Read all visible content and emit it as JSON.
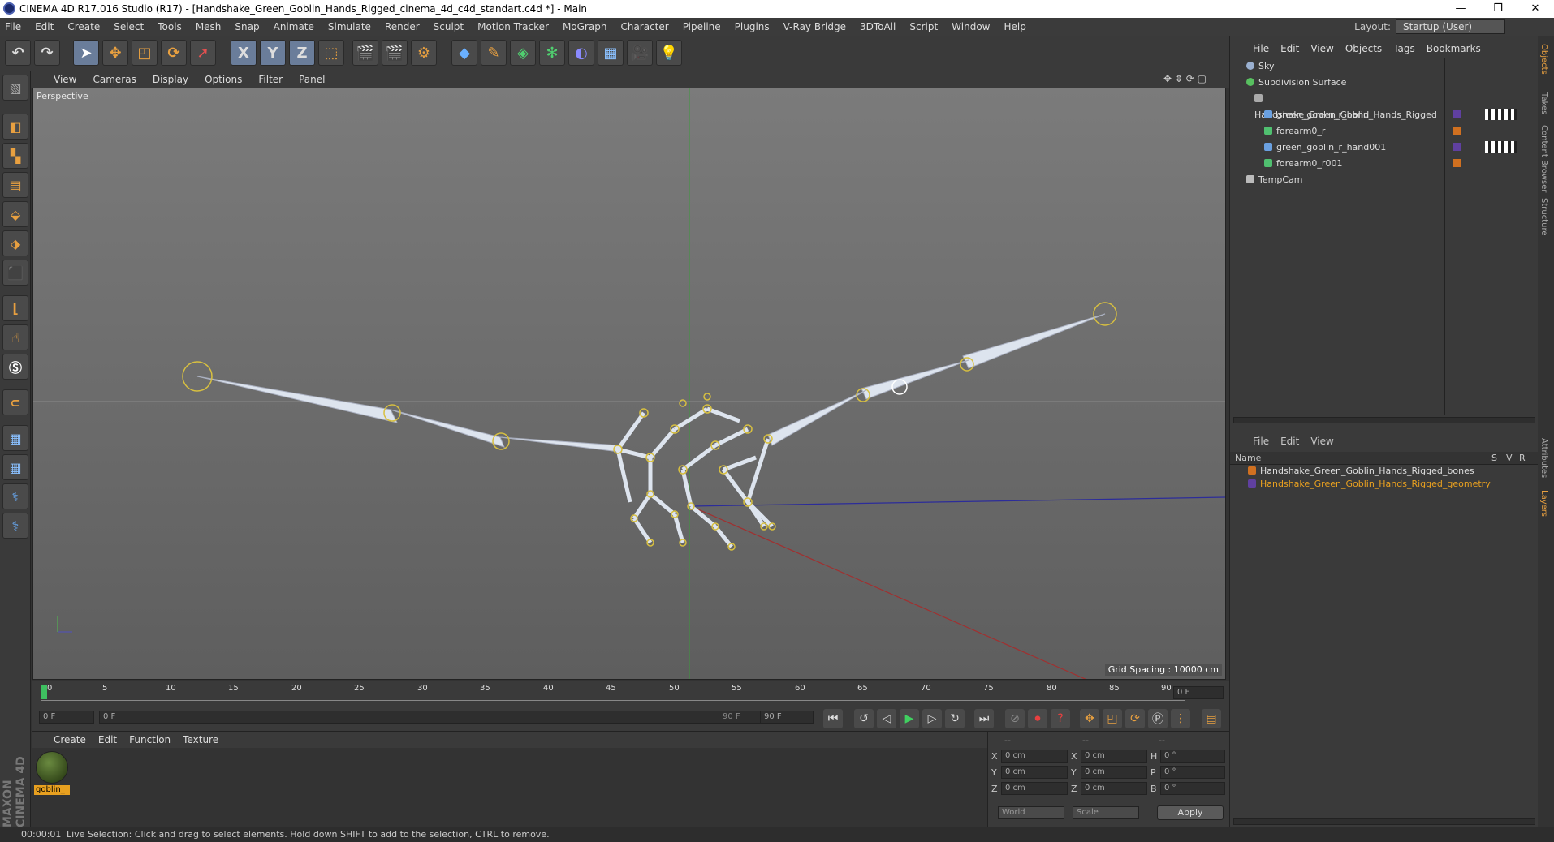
{
  "window": {
    "title": "CINEMA 4D R17.016 Studio (R17) - [Handshake_Green_Goblin_Hands_Rigged_cinema_4d_c4d_standart.c4d *] - Main",
    "buttons": [
      "—",
      "❐",
      "✕"
    ]
  },
  "menu": [
    "File",
    "Edit",
    "Create",
    "Select",
    "Tools",
    "Mesh",
    "Snap",
    "Animate",
    "Simulate",
    "Render",
    "Sculpt",
    "Motion Tracker",
    "MoGraph",
    "Character",
    "Pipeline",
    "Plugins",
    "V-Ray Bridge",
    "3DToAll",
    "Script",
    "Window",
    "Help"
  ],
  "layout": {
    "label": "Layout:",
    "value": "Startup (User)"
  },
  "toolbar": {
    "x": "X",
    "y": "Y",
    "z": "Z"
  },
  "viewport": {
    "menu": [
      "View",
      "Cameras",
      "Display",
      "Options",
      "Filter",
      "Panel"
    ],
    "label": "Perspective",
    "grid_spacing": "Grid Spacing : 10000 cm"
  },
  "timeline": {
    "ticks": [
      "0",
      "5",
      "10",
      "15",
      "20",
      "25",
      "30",
      "35",
      "40",
      "45",
      "50",
      "55",
      "60",
      "65",
      "70",
      "75",
      "80",
      "85",
      "90"
    ],
    "current_frame": "0 F",
    "start": "0 F",
    "range_start": "0 F",
    "range_end": "90 F",
    "end": "90 F"
  },
  "material": {
    "menu": [
      "Create",
      "Edit",
      "Function",
      "Texture"
    ],
    "name": "goblin_"
  },
  "coords": {
    "headers": [
      "--",
      "--",
      "--"
    ],
    "rows": [
      {
        "a": "X",
        "av": "0 cm",
        "b": "X",
        "bv": "0 cm",
        "c": "H",
        "cv": "0 °"
      },
      {
        "a": "Y",
        "av": "0 cm",
        "b": "Y",
        "bv": "0 cm",
        "c": "P",
        "cv": "0 °"
      },
      {
        "a": "Z",
        "av": "0 cm",
        "b": "Z",
        "bv": "0 cm",
        "c": "B",
        "cv": "0 °"
      }
    ],
    "world": "World",
    "scale": "Scale",
    "apply": "Apply"
  },
  "objects": {
    "menu": [
      "File",
      "Edit",
      "View",
      "Objects",
      "Tags",
      "Bookmarks"
    ],
    "items": [
      {
        "label": "Sky",
        "color": "#9ab0d0"
      },
      {
        "label": "Subdivision Surface",
        "color": "#58c060"
      },
      {
        "label": "Handshake_Green_Goblin_Hands_Rigged",
        "color": "#aaaaaa"
      },
      {
        "label": "green_goblin_r_hand",
        "color": "#6aa0e0"
      },
      {
        "label": "forearm0_r",
        "color": "#50c070"
      },
      {
        "label": "green_goblin_r_hand001",
        "color": "#6aa0e0"
      },
      {
        "label": "forearm0_r001",
        "color": "#50c070"
      },
      {
        "label": "TempCam",
        "color": "#bbbbbb"
      }
    ]
  },
  "layers": {
    "menu": [
      "File",
      "Edit",
      "View"
    ],
    "header": {
      "name": "Name",
      "s": "S",
      "v": "V",
      "r": "R"
    },
    "items": [
      {
        "label": "Handshake_Green_Goblin_Hands_Rigged_bones",
        "color": "#d07020"
      },
      {
        "label": "Handshake_Green_Goblin_Hands_Rigged_geometry",
        "color": "#6040a0"
      }
    ]
  },
  "side_tabs": [
    "Objects",
    "Takes",
    "Content Browser",
    "Structure",
    "Attributes",
    "Layers"
  ],
  "status": {
    "time": "00:00:01",
    "message": "Live Selection: Click and drag to select elements. Hold down SHIFT to add to the selection, CTRL to remove."
  },
  "brand": "MAXON CINEMA 4D"
}
